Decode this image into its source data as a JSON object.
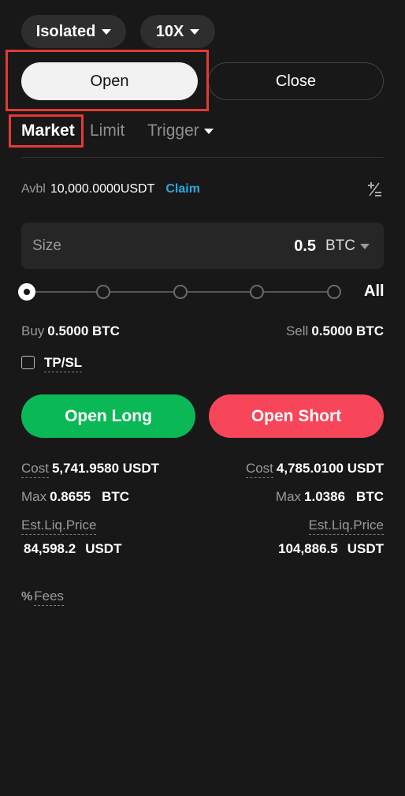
{
  "header": {
    "margin_mode": "Isolated",
    "leverage": "10X"
  },
  "position_tabs": {
    "open": "Open",
    "close": "Close"
  },
  "order_types": {
    "market": "Market",
    "limit": "Limit",
    "trigger": "Trigger"
  },
  "balance": {
    "label": "Avbl",
    "value": "10,000.0000USDT",
    "claim": "Claim"
  },
  "size": {
    "label": "Size",
    "value": "0.5",
    "unit": "BTC"
  },
  "slider": {
    "all_label": "All",
    "level": 0
  },
  "amounts": {
    "buy_label": "Buy",
    "buy_value": "0.5000 BTC",
    "sell_label": "Sell",
    "sell_value": "0.5000 BTC"
  },
  "tpsl": {
    "label": "TP/SL",
    "checked": false
  },
  "actions": {
    "long": "Open Long",
    "short": "Open Short",
    "long_color": "#0bb856",
    "short_color": "#f7455a"
  },
  "long_info": {
    "cost_label": "Cost",
    "cost_value": "5,741.9580 USDT",
    "max_label": "Max",
    "max_value": "0.8655",
    "max_unit": "BTC",
    "liq_label": "Est.Liq.Price",
    "liq_value": "84,598.2",
    "liq_unit": "USDT"
  },
  "short_info": {
    "cost_label": "Cost",
    "cost_value": "4,785.0100 USDT",
    "max_label": "Max",
    "max_value": "1.0386",
    "max_unit": "BTC",
    "liq_label": "Est.Liq.Price",
    "liq_value": "104,886.5",
    "liq_unit": "USDT"
  },
  "fees": {
    "label": "Fees"
  },
  "accent": "#29a9e0"
}
